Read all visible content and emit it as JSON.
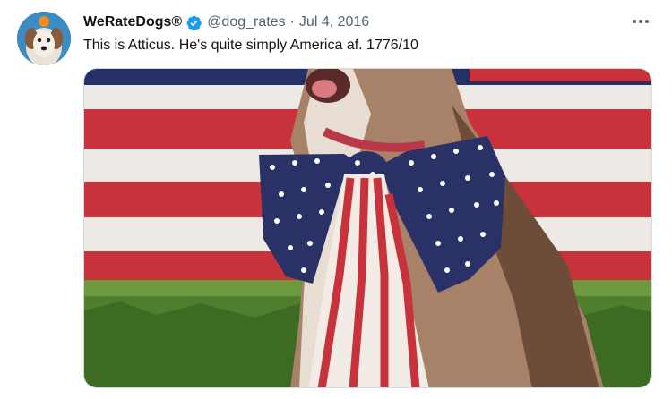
{
  "tweet": {
    "display_name": "WeRateDogs®",
    "handle": "@dog_rates",
    "separator": "·",
    "date": "Jul 4, 2016",
    "text": "This is Atticus. He's quite simply America af. 1776/10",
    "verified": true
  },
  "icons": {
    "verified": "verified-badge-icon",
    "more": "more-options-icon"
  },
  "colors": {
    "accent": "#1d9bf0",
    "text": "#0f1419",
    "muted": "#536471",
    "flag_red": "#c8323a",
    "flag_blue": "#24306a"
  }
}
